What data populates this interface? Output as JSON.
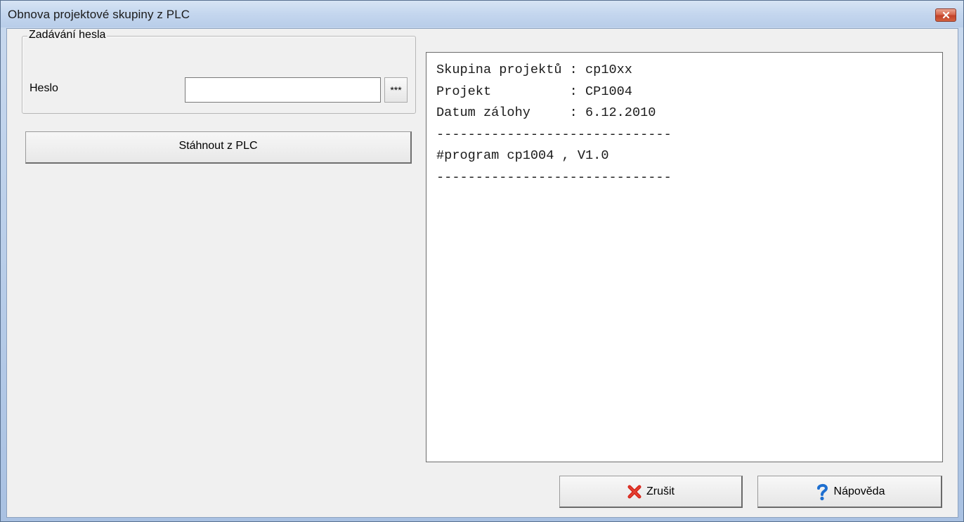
{
  "window": {
    "title": "Obnova projektové skupiny z PLC",
    "close_icon": "close-icon"
  },
  "password_group": {
    "legend": "Zadávání hesla",
    "label": "Heslo",
    "value": "",
    "reveal_button_label": "***"
  },
  "download_button_label": "Stáhnout z PLC",
  "info_panel": {
    "lines": [
      "Skupina projektů : cp10xx",
      "Projekt          : CP1004",
      "Datum zálohy     : 6.12.2010",
      "------------------------------",
      "#program cp1004 , V1.0",
      "------------------------------"
    ]
  },
  "buttons": {
    "cancel_label": "Zrušit",
    "cancel_icon": "red-x-icon",
    "help_label": "Nápověda",
    "help_icon": "question-mark-icon"
  },
  "colors": {
    "title_bar": "#c4d6ee",
    "close_button": "#c2412a",
    "cancel_icon": "#d6261c",
    "help_icon": "#1e6fd0"
  }
}
